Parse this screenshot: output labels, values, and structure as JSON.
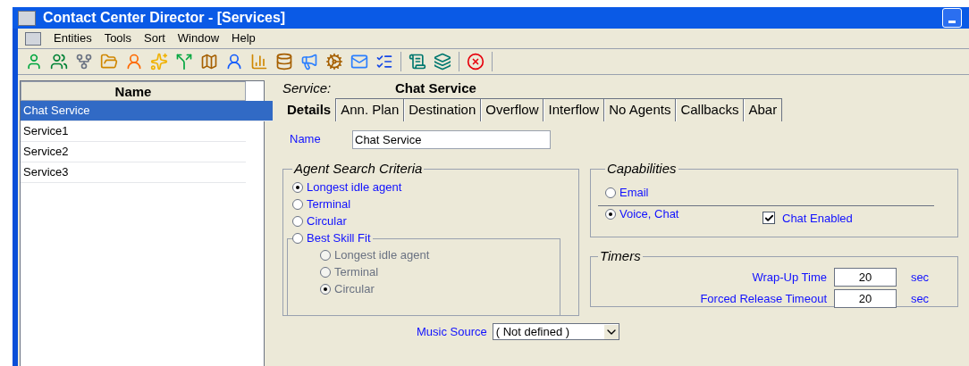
{
  "window": {
    "title": "Contact Center Director - [Services]"
  },
  "menu": [
    "Entities",
    "Tools",
    "Sort",
    "Window",
    "Help"
  ],
  "list": {
    "header": "Name",
    "rows": [
      {
        "label": "Chat Service",
        "selected": true
      },
      {
        "label": "Service1",
        "selected": false
      },
      {
        "label": "Service2",
        "selected": false
      },
      {
        "label": "Service3",
        "selected": false
      }
    ]
  },
  "service": {
    "label": "Service:",
    "value": "Chat Service"
  },
  "tabs": [
    {
      "label": "Details",
      "selected": true
    },
    {
      "label": "Ann. Plan",
      "selected": false
    },
    {
      "label": "Destination",
      "selected": false
    },
    {
      "label": "Overflow",
      "selected": false
    },
    {
      "label": "Interflow",
      "selected": false
    },
    {
      "label": "No Agents",
      "selected": false
    },
    {
      "label": "Callbacks",
      "selected": false
    },
    {
      "label": "Abar",
      "selected": false
    }
  ],
  "name_field": {
    "label": "Name",
    "value": "Chat Service"
  },
  "agent_search": {
    "title": "Agent Search Criteria",
    "options": [
      {
        "label": "Longest idle agent",
        "selected": true
      },
      {
        "label": "Terminal",
        "selected": false
      },
      {
        "label": "Circular",
        "selected": false
      },
      {
        "label": "Best Skill Fit",
        "selected": false
      }
    ],
    "sub_options": [
      {
        "label": "Longest idle agent",
        "selected": false,
        "disabled": true
      },
      {
        "label": "Terminal",
        "selected": false,
        "disabled": true
      },
      {
        "label": "Circular",
        "selected": true,
        "disabled": true
      }
    ]
  },
  "capabilities": {
    "title": "Capabilities",
    "options": [
      {
        "label": "Email",
        "selected": false
      },
      {
        "label": "Voice, Chat",
        "selected": true
      }
    ],
    "chat_enabled": {
      "label": "Chat Enabled",
      "checked": true
    }
  },
  "timers": {
    "title": "Timers",
    "rows": [
      {
        "label": "Wrap-Up Time",
        "value": "20",
        "unit": "sec"
      },
      {
        "label": "Forced Release Timeout",
        "value": "20",
        "unit": "sec"
      }
    ]
  },
  "music_source": {
    "label": "Music Source",
    "value": "( Not defined )"
  }
}
